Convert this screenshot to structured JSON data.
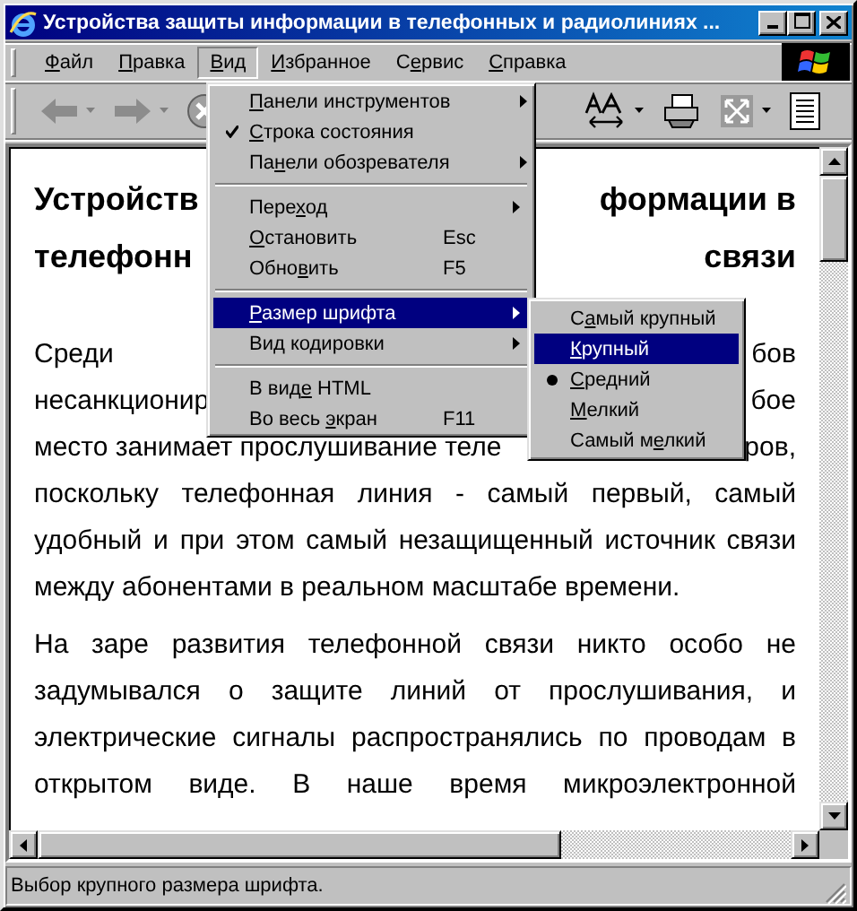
{
  "window": {
    "title": "Устройства защиты информации в телефонных и радиолиниях ..."
  },
  "menu_bar": [
    {
      "label": [
        {
          "text": "Ф",
          "key": true
        },
        {
          "text": "айл",
          "key": false
        }
      ],
      "selected": false
    },
    {
      "label": [
        {
          "text": "П",
          "key": true
        },
        {
          "text": "равка",
          "key": false
        }
      ],
      "selected": false
    },
    {
      "label": [
        {
          "text": "В",
          "key": true
        },
        {
          "text": "ид",
          "key": false
        }
      ],
      "selected": true
    },
    {
      "label": [
        {
          "text": "И",
          "key": true
        },
        {
          "text": "збранное",
          "key": false
        }
      ],
      "selected": false
    },
    {
      "label": [
        {
          "text": "С",
          "key": false
        },
        {
          "text": "е",
          "key": true
        },
        {
          "text": "рвис",
          "key": false
        }
      ],
      "selected": false
    },
    {
      "label": [
        {
          "text": "С",
          "key": true
        },
        {
          "text": "правка",
          "key": false
        }
      ],
      "selected": false
    }
  ],
  "view_menu": [
    {
      "kind": "item",
      "label": [
        {
          "text": "П",
          "key": true
        },
        {
          "text": "анели инструментов",
          "key": false
        }
      ],
      "submenu": true,
      "checked": false,
      "highlighted": false
    },
    {
      "kind": "item",
      "label": [
        {
          "text": "С",
          "key": true
        },
        {
          "text": "трока состояния",
          "key": false
        }
      ],
      "submenu": false,
      "checked": true,
      "highlighted": false
    },
    {
      "kind": "item",
      "label": [
        {
          "text": "Па",
          "key": false
        },
        {
          "text": "н",
          "key": true
        },
        {
          "text": "ели обозревателя",
          "key": false
        }
      ],
      "submenu": true,
      "checked": false,
      "highlighted": false
    },
    {
      "kind": "separator"
    },
    {
      "kind": "item",
      "label": [
        {
          "text": "Пере",
          "key": false
        },
        {
          "text": "х",
          "key": true
        },
        {
          "text": "од",
          "key": false
        }
      ],
      "submenu": true,
      "checked": false,
      "highlighted": false
    },
    {
      "kind": "item",
      "label": [
        {
          "text": "О",
          "key": true
        },
        {
          "text": "становить",
          "key": false
        }
      ],
      "shortcut": "Esc",
      "submenu": false,
      "checked": false,
      "highlighted": false
    },
    {
      "kind": "item",
      "label": [
        {
          "text": "Обно",
          "key": false
        },
        {
          "text": "в",
          "key": true
        },
        {
          "text": "ить",
          "key": false
        }
      ],
      "shortcut": "F5",
      "submenu": false,
      "checked": false,
      "highlighted": false
    },
    {
      "kind": "separator"
    },
    {
      "kind": "item",
      "label": [
        {
          "text": "Р",
          "key": true
        },
        {
          "text": "азмер шрифта",
          "key": false
        }
      ],
      "submenu": true,
      "checked": false,
      "highlighted": true
    },
    {
      "kind": "item",
      "label": [
        {
          "text": "Вид кодировки",
          "key": false
        }
      ],
      "submenu": true,
      "checked": false,
      "highlighted": false
    },
    {
      "kind": "separator"
    },
    {
      "kind": "item",
      "label": [
        {
          "text": "В вид",
          "key": false
        },
        {
          "text": "е",
          "key": true
        },
        {
          "text": " HTML",
          "key": false
        }
      ],
      "submenu": false,
      "checked": false,
      "highlighted": false
    },
    {
      "kind": "item",
      "label": [
        {
          "text": "Во весь ",
          "key": false
        },
        {
          "text": "э",
          "key": true
        },
        {
          "text": "кран",
          "key": false
        }
      ],
      "shortcut": "F11",
      "submenu": false,
      "checked": false,
      "highlighted": false
    }
  ],
  "font_size_menu": [
    {
      "label": [
        {
          "text": "С",
          "key": false
        },
        {
          "text": "а",
          "key": true
        },
        {
          "text": "мый крупный",
          "key": false
        }
      ],
      "selected": false,
      "highlighted": false
    },
    {
      "label": [
        {
          "text": "К",
          "key": true
        },
        {
          "text": "рупный",
          "key": false
        }
      ],
      "selected": false,
      "highlighted": true
    },
    {
      "label": [
        {
          "text": "С",
          "key": true
        },
        {
          "text": "редний",
          "key": false
        }
      ],
      "selected": true,
      "highlighted": false
    },
    {
      "label": [
        {
          "text": "М",
          "key": true
        },
        {
          "text": "елкий",
          "key": false
        }
      ],
      "selected": false,
      "highlighted": false
    },
    {
      "label": [
        {
          "text": "Самый м",
          "key": false
        },
        {
          "text": "е",
          "key": true
        },
        {
          "text": "лкий",
          "key": false
        }
      ],
      "selected": false,
      "highlighted": false
    }
  ],
  "document": {
    "heading": [
      {
        "parts": [
          "Устройств",
          "формации в"
        ]
      },
      {
        "parts": [
          "телефонн",
          "связи"
        ]
      }
    ],
    "lines": [
      {
        "parts": [
          "Среди",
          "бов"
        ]
      },
      {
        "parts": [
          "несанкционир",
          "бое"
        ]
      },
      {
        "parts": [
          "место занимает прослушивание теле",
          "ров,"
        ]
      },
      {
        "parts": [
          "поскольку телефонная линия - самый первый, самый"
        ],
        "justified": true
      },
      {
        "parts": [
          "удобный и при этом самый незащищенный источник связи"
        ],
        "justified": true
      },
      {
        "parts": [
          "между абонентами в реальном масштабе времени."
        ],
        "justified": false
      },
      {
        "parts": [
          "На заре развития телефонной связи никто особо не"
        ],
        "justified": true
      },
      {
        "parts": [
          "задумывался о защите линий от прослушивания, и"
        ],
        "justified": true
      },
      {
        "parts": [
          "электрические сигналы распространялись по проводам в"
        ],
        "justified": true
      },
      {
        "parts": [
          "открытом виде. В наше время микроэлектронной"
        ],
        "justified": true
      }
    ]
  },
  "status_bar": {
    "text": "Выбор крупного размера шрифта."
  }
}
